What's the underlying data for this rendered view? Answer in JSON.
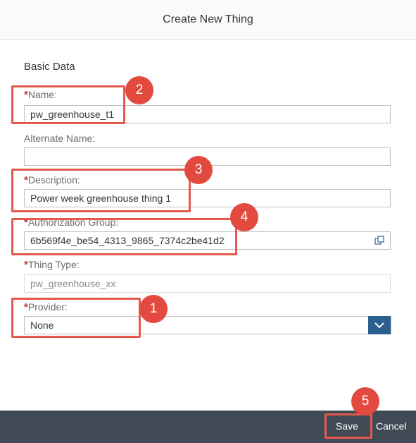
{
  "dialog": {
    "title": "Create New Thing",
    "section_title": "Basic Data",
    "required_marker": "*"
  },
  "fields": {
    "name": {
      "label": "Name:",
      "value": "pw_greenhouse_t1"
    },
    "alternate_name": {
      "label": "Alternate Name:",
      "value": ""
    },
    "description": {
      "label": "Description:",
      "value": "Power week greenhouse thing 1"
    },
    "authorization_group": {
      "label": "Authorization Group:",
      "value": "6b569f4e_be54_4313_9865_7374c2be41d2"
    },
    "thing_type": {
      "label": "Thing Type:",
      "placeholder": "pw_greenhouse_xx"
    },
    "provider": {
      "label": "Provider:",
      "selected": "None"
    }
  },
  "footer": {
    "save_label": "Save",
    "cancel_label": "Cancel"
  },
  "callouts": [
    "1",
    "2",
    "3",
    "4",
    "5"
  ],
  "colors": {
    "highlight": "#e5584d",
    "accent": "#2c5f8d",
    "footer": "#3f4a55"
  }
}
